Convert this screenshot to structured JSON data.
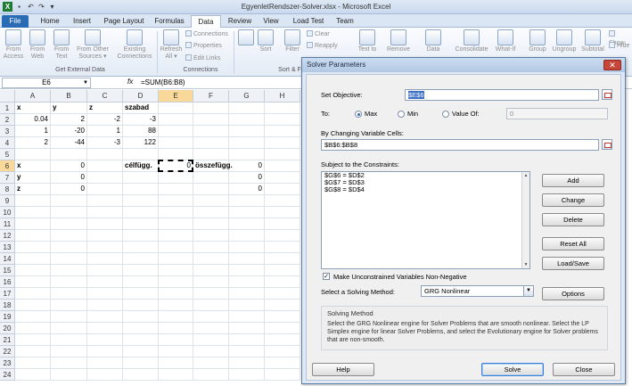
{
  "window": {
    "title": "EgyenletRendszer-Solver.xlsx - Microsoft Excel"
  },
  "ribbon": {
    "tabs": [
      "File",
      "Home",
      "Insert",
      "Page Layout",
      "Formulas",
      "Data",
      "Review",
      "View",
      "Load Test",
      "Team"
    ],
    "active_tab": "Data",
    "buttons": {
      "from_access": "From\nAccess",
      "from_web": "From\nWeb",
      "from_text": "From\nText",
      "from_other": "From Other\nSources ▾",
      "existing": "Existing\nConnections",
      "refresh_all": "Refresh\nAll ▾",
      "sort": "Sort",
      "filter": "Filter",
      "text_to": "Text to",
      "remove": "Remove",
      "data": "Data",
      "consolidate": "Consolidate",
      "what_if": "What-If",
      "group": "Group",
      "ungroup": "Ungroup",
      "subtotal": "Subtotal"
    },
    "small": {
      "connections": "Connections",
      "properties": "Properties",
      "edit_links": "Edit Links",
      "clear": "Clear",
      "reapply": "Reapply",
      "show": "Show",
      "hide": "Hide"
    },
    "groups": {
      "get_external": "Get External Data",
      "connections": "Connections",
      "sort_filter": "Sort & F"
    }
  },
  "formula_bar": {
    "name_box": "E6",
    "fx": "fx",
    "formula": "=SUM(B6:B8)"
  },
  "sheet": {
    "columns": [
      "A",
      "B",
      "C",
      "D",
      "E",
      "F",
      "G",
      "H"
    ],
    "rows": [
      "1",
      "2",
      "3",
      "4",
      "5",
      "6",
      "7",
      "8",
      "9",
      "10",
      "11",
      "12",
      "13",
      "14",
      "15",
      "16",
      "17",
      "18",
      "19",
      "20",
      "21",
      "22",
      "23",
      "24"
    ],
    "cells": {
      "A1": "x",
      "B1": "y",
      "C1": "z",
      "D1": "szabad",
      "A2": "0.04",
      "B2": "2",
      "C2": "-2",
      "D2": "-3",
      "A3": "1",
      "B3": "-20",
      "C3": "1",
      "D3": "88",
      "A4": "2",
      "B4": "-44",
      "C4": "-3",
      "D4": "122",
      "A6": "x",
      "B6": "0",
      "D6": "célfügg.",
      "E6": "0",
      "F6": "összefügg.",
      "G6": "0",
      "A7": "y",
      "B7": "0",
      "G7": "0",
      "A8": "z",
      "B8": "0",
      "G8": "0"
    }
  },
  "dialog": {
    "title": "Solver Parameters",
    "set_objective_label": "Set Objective:",
    "set_objective_value": "$E$6",
    "to_label": "To:",
    "max_label": "Max",
    "min_label": "Min",
    "value_of_label": "Value Of:",
    "value_of_value": "0",
    "changing_label": "By Changing Variable Cells:",
    "changing_value": "$B$6:$B$8",
    "constraints_label": "Subject to the Constraints:",
    "constraints": [
      "$G$6 = $D$2",
      "$G$7 = $D$3",
      "$G$8 = $D$4"
    ],
    "add": "Add",
    "change": "Change",
    "delete": "Delete",
    "reset_all": "Reset All",
    "load_save": "Load/Save",
    "nonneg_label": "Make Unconstrained Variables Non-Negative",
    "method_label": "Select a Solving Method:",
    "method_value": "GRG Nonlinear",
    "options": "Options",
    "solving_method_title": "Solving Method",
    "solving_method_desc": "Select the GRG Nonlinear engine for Solver Problems that are smooth nonlinear. Select the LP Simplex engine for linear Solver Problems, and select the Evolutionary engine for Solver problems that are non-smooth.",
    "help": "Help",
    "solve": "Solve",
    "close": "Close"
  }
}
